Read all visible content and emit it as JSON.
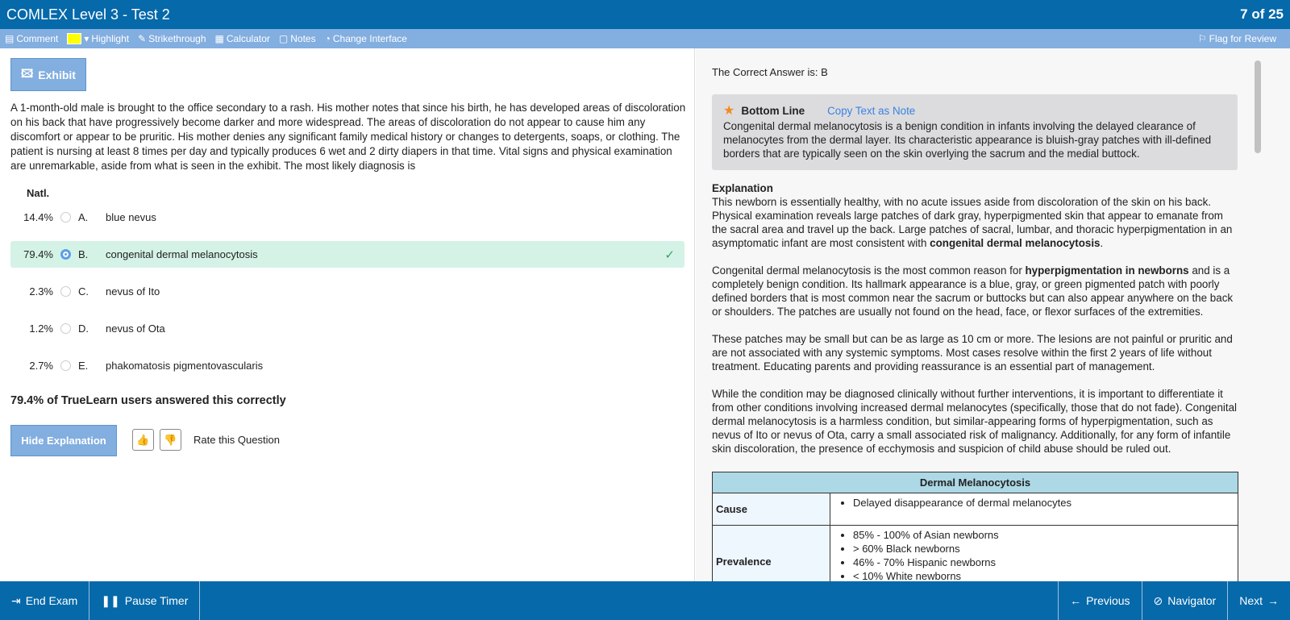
{
  "header": {
    "title": "COMLEX Level 3 - Test 2",
    "counter": "7 of 25"
  },
  "toolbar": {
    "comment": "Comment",
    "highlight": "Highlight",
    "highlight_color": "#ffff00",
    "strikethrough": "Strikethrough",
    "calculator": "Calculator",
    "notes": "Notes",
    "change_interface": "Change Interface",
    "flag": "Flag for Review"
  },
  "question": {
    "exhibit": "Exhibit",
    "stem": "A 1-month-old male is brought to the office secondary to a rash. His mother notes that since his birth, he has developed areas of discoloration on his back that have progressively become darker and more widespread. The areas of discoloration do not appear to cause him any discomfort or appear to be pruritic. His mother denies any significant family medical history or changes to detergents, soaps, or clothing. The patient is nursing at least 8 times per day and typically produces 6 wet and 2 dirty diapers in that time. Vital signs and physical examination are unremarkable, aside from what is seen in the exhibit. The most likely diagnosis is",
    "natl_label": "Natl.",
    "options": [
      {
        "pct": "14.4%",
        "letter": "A.",
        "text": "blue nevus"
      },
      {
        "pct": "79.4%",
        "letter": "B.",
        "text": "congenital dermal melanocytosis"
      },
      {
        "pct": "2.3%",
        "letter": "C.",
        "text": "nevus of Ito"
      },
      {
        "pct": "1.2%",
        "letter": "D.",
        "text": "nevus of Ota"
      },
      {
        "pct": "2.7%",
        "letter": "E.",
        "text": "phakomatosis pigmentovascularis"
      }
    ],
    "selected": "B",
    "stat": "79.4% of TrueLearn users answered this correctly",
    "hide_explanation": "Hide Explanation",
    "rate": "Rate this Question"
  },
  "explanation": {
    "correct": "The Correct Answer is: B",
    "bottom_line_title": "Bottom Line",
    "copy": "Copy Text as Note",
    "bottom_line": "Congenital dermal melanocytosis is a benign condition in infants involving the delayed clearance of melanocytes from the dermal layer. Its characteristic appearance is bluish-gray patches with ill-defined borders that are typically seen on the skin overlying the sacrum and the medial buttock.",
    "heading": "Explanation",
    "paragraphs": [
      [
        {
          "t": "This newborn is essentially healthy, with no acute issues aside from discoloration of the skin on his back. Physical examination reveals large patches of dark gray, hyperpigmented skin that appear to emanate from the sacral area and travel up the back. Large patches of sacral, lumbar, and thoracic hyperpigmentation in an asymptomatic infant are most consistent with "
        },
        {
          "t": "congenital dermal melanocytosis",
          "b": true
        },
        {
          "t": "."
        }
      ],
      [
        {
          "t": "Congenital dermal melanocytosis is the most common reason for "
        },
        {
          "t": "hyperpigmentation in newborns",
          "b": true
        },
        {
          "t": " and is a completely benign condition. Its hallmark appearance is a blue, gray, or green pigmented patch with poorly defined borders that is most common near the sacrum or buttocks but can also appear anywhere on the back or shoulders. The patches are usually not found on the head, face, or flexor surfaces of the extremities."
        }
      ],
      [
        {
          "t": "These patches may be small but can be as large as 10 cm or more. The lesions are not painful or pruritic and are not associated with any systemic symptoms. Most cases resolve within the first 2 years of life without treatment. Educating parents and providing reassurance is an essential part of management."
        }
      ],
      [
        {
          "t": "While the condition may be diagnosed clinically without further interventions, it is important to differentiate it from other conditions involving increased dermal melanocytes (specifically, those that do not fade). Congenital dermal melanocytosis is a harmless condition, but similar-appearing forms of hyperpigmentation, such as nevus of Ito or nevus of Ota, carry a small associated risk of malignancy. Additionally, for any form of infantile skin discoloration, the presence of ecchymosis and suspicion of child abuse should be ruled out."
        }
      ]
    ],
    "table": {
      "title": "Dermal Melanocytosis",
      "rows": [
        {
          "key": "Cause",
          "items": [
            "Delayed disappearance of dermal melanocytes"
          ]
        },
        {
          "key": "Prevalence",
          "items": [
            "85% - 100% of Asian newborns",
            "> 60% Black newborns",
            "46% - 70% Hispanic newborns",
            "< 10% White newborns"
          ]
        }
      ]
    }
  },
  "footer": {
    "end": "End Exam",
    "pause": "Pause Timer",
    "previous": "Previous",
    "navigator": "Navigator",
    "next": "Next"
  }
}
